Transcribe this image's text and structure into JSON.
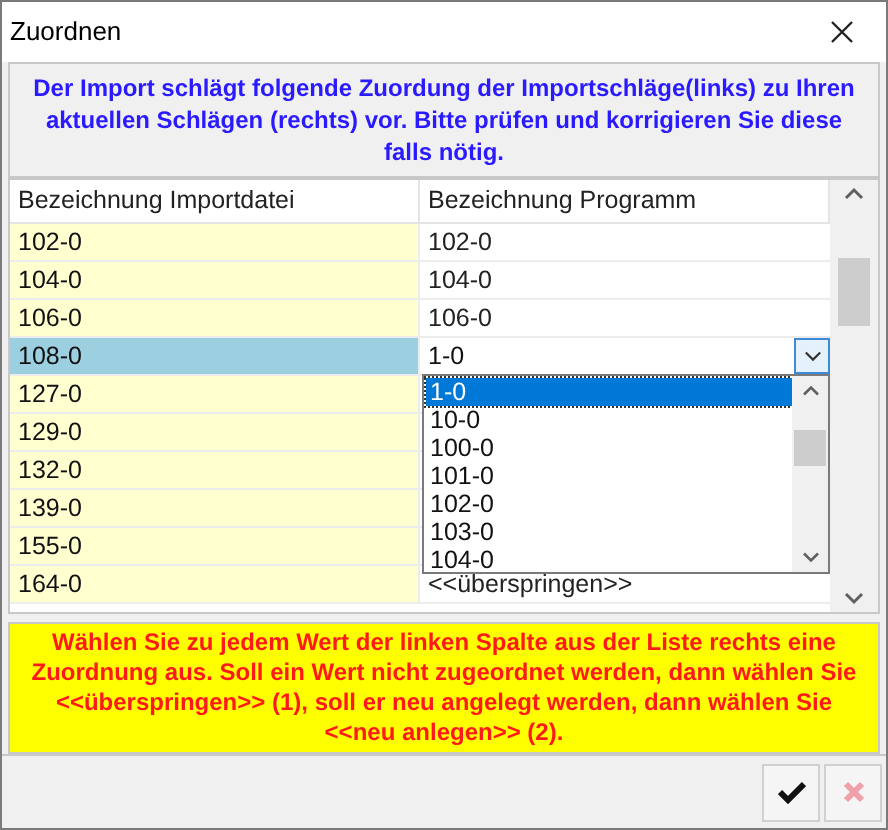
{
  "window": {
    "title": "Zuordnen"
  },
  "info": "Der Import schlägt folgende Zuordung der Importschläge(links) zu Ihren aktuellen Schlägen (rechts) vor. Bitte prüfen und korrigieren Sie diese falls nötig.",
  "grid": {
    "columns": [
      "Bezeichnung Importdatei",
      "Bezeichnung Programm"
    ],
    "rows": [
      {
        "import": "102-0",
        "program": "102-0",
        "selected": false
      },
      {
        "import": "104-0",
        "program": "104-0",
        "selected": false
      },
      {
        "import": "106-0",
        "program": "106-0",
        "selected": false
      },
      {
        "import": "108-0",
        "program": "1-0",
        "selected": true
      },
      {
        "import": "127-0",
        "selected": false
      },
      {
        "import": "129-0",
        "selected": false
      },
      {
        "import": "132-0",
        "selected": false
      },
      {
        "import": "139-0",
        "selected": false
      },
      {
        "import": "155-0",
        "selected": false
      },
      {
        "import": "164-0",
        "program": "<<überspringen>>",
        "selected": false
      }
    ],
    "dropdown": [
      {
        "label": "1-0",
        "selected": true
      },
      {
        "label": "10-0",
        "selected": false
      },
      {
        "label": "100-0",
        "selected": false
      },
      {
        "label": "101-0",
        "selected": false
      },
      {
        "label": "102-0",
        "selected": false
      },
      {
        "label": "103-0",
        "selected": false
      },
      {
        "label": "104-0",
        "selected": false
      }
    ]
  },
  "hint": "Wählen Sie zu jedem Wert der linken Spalte aus der Liste rechts eine Zuordnung aus. Soll ein Wert nicht zugeordnet werden, dann wählen Sie <<überspringen>> (1), soll er neu angelegt werden, dann wählen Sie <<neu anlegen>> (2)."
}
